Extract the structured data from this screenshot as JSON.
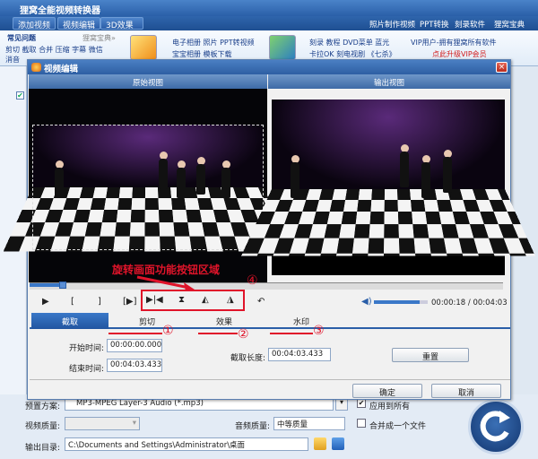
{
  "app": {
    "title": "狸窝全能视频转换器"
  },
  "toolbar": {
    "add_video": "添加视频",
    "edit_video": "视频编辑",
    "effect_3d": "3D效果",
    "links": [
      "照片制作视频",
      "PPT转换",
      "刻录软件",
      "狸窝宝典"
    ]
  },
  "banner": {
    "faq": "常见问题",
    "treasure": "狸窝宝典»",
    "left_line1": "剪切 截取 合并 压缩 字幕 微信",
    "left_line2": "消音",
    "col1_line1": "电子相册 照片 PPT转视频",
    "col1_line2": "宝宝相册 模板下载",
    "col2_line1": "刻录 教程 DVD菜单 蓝光",
    "col2_line2": "卡拉OK 刻电视剧 《七杀》",
    "vip_line1": "VIP用户-拥有狸窝所有软件",
    "vip_line2": "点此升级VIP会员"
  },
  "dialog": {
    "title": "视频编辑",
    "orig_view": "原始视图",
    "output_view": "输出视图",
    "time": "00:00:18 / 00:04:03",
    "annotation": "旋转画面功能按钮区域",
    "circled": [
      "④",
      "①",
      "②",
      "③"
    ],
    "tabs": [
      "截取",
      "剪切",
      "效果",
      "水印"
    ],
    "start_label": "开始时间:",
    "start_value": "00:00:00.000",
    "end_label": "结束时间:",
    "end_value": "00:04:03.433",
    "length_label": "截取长度:",
    "length_value": "00:04:03.433",
    "reset": "重置",
    "ok": "确定",
    "cancel": "取消",
    "playback": {
      "played_fraction": 0.07,
      "volume_fraction": 0.85
    }
  },
  "bottom": {
    "preset_label": "预置方案:",
    "preset_value": "MP3-MPEG Layer-3 Audio (*.mp3)",
    "apply_all": "应用到所有",
    "video_quality_label": "视频质量:",
    "audio_quality_label": "音频质量:",
    "audio_quality_value": "中等质量",
    "merge": "合并成一个文件",
    "output_label": "输出目录:",
    "output_value": "C:\\Documents and Settings\\Administrator\\桌面"
  }
}
